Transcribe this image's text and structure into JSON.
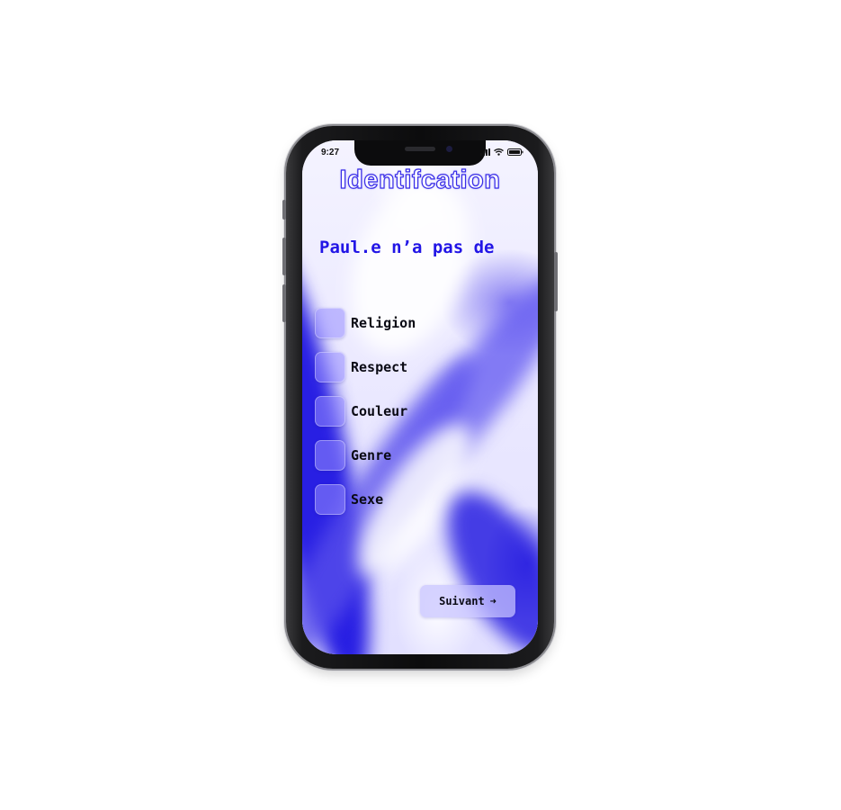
{
  "status_bar": {
    "time": "9:27",
    "icons": [
      "signal-icon",
      "wifi-icon",
      "battery-icon"
    ]
  },
  "screen": {
    "title": "Identifcation",
    "question": "Paul.e n’a pas de",
    "options": [
      {
        "label": "Religion",
        "checked": false
      },
      {
        "label": "Respect",
        "checked": false
      },
      {
        "label": "Couleur",
        "checked": false
      },
      {
        "label": "Genre",
        "checked": false
      },
      {
        "label": "Sexe",
        "checked": false
      }
    ],
    "next_button": {
      "label": "Suivant",
      "icon": "arrow-right-icon",
      "arrow": "➜"
    }
  },
  "colors": {
    "accent": "#2215e6",
    "checkbox": "#968cff",
    "button": "#c8c4ff"
  }
}
